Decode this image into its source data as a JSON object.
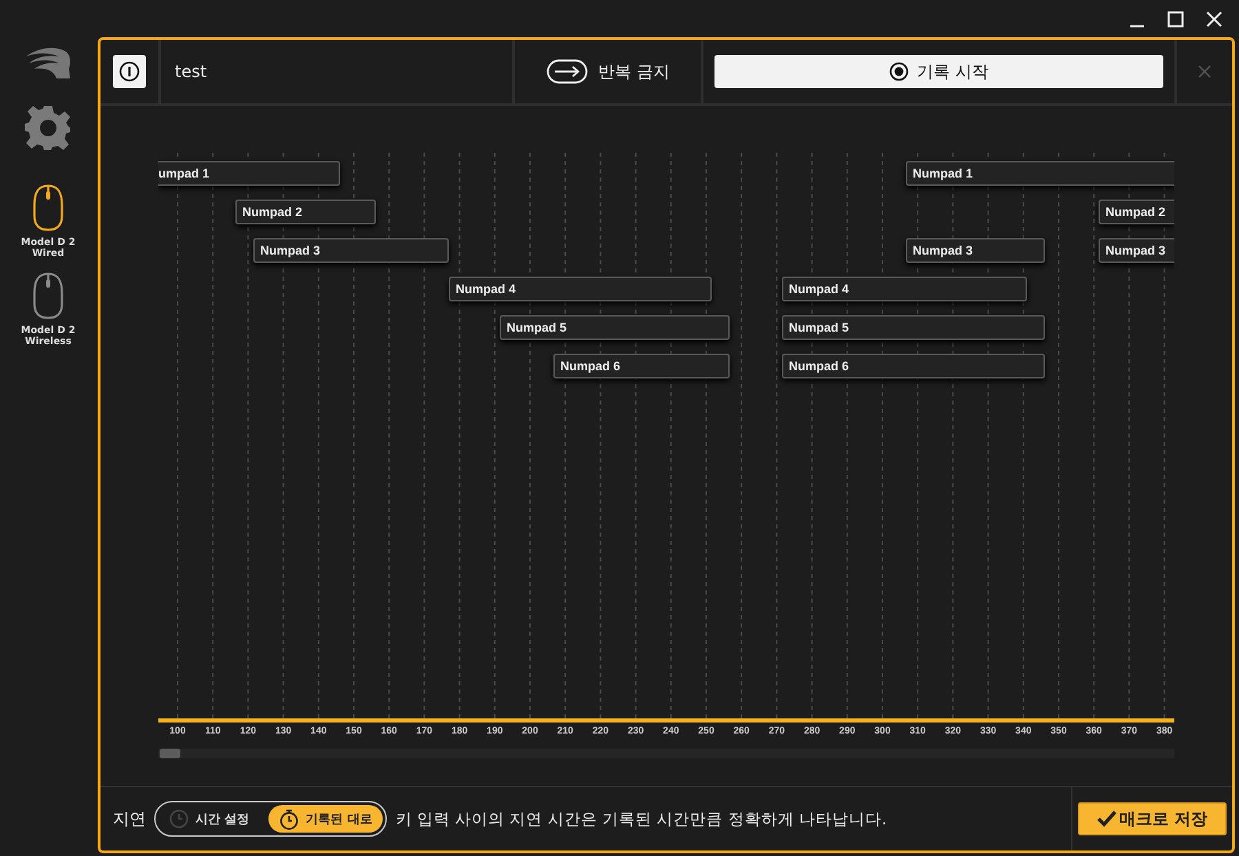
{
  "sidebar": {
    "devices": [
      {
        "label": "Model D 2 Wired",
        "selected": true
      },
      {
        "label": "Model D 2 Wireless",
        "selected": false
      }
    ]
  },
  "header": {
    "macro_name": "test",
    "repeat": {
      "label": "반복 금지"
    },
    "record_button": {
      "label": "기록 시작"
    }
  },
  "timeline": {
    "tracks": [
      {
        "events": [
          {
            "label": "umpad 1"
          },
          {
            "label": "Numpad 1"
          }
        ]
      },
      {
        "events": [
          {
            "label": "Numpad 2"
          },
          {
            "label": "Numpad 2"
          }
        ]
      },
      {
        "events": [
          {
            "label": "Numpad 3"
          },
          {
            "label": "Numpad 3"
          },
          {
            "label": "Numpad 3"
          }
        ]
      },
      {
        "events": [
          {
            "label": "Numpad 4"
          },
          {
            "label": "Numpad 4"
          }
        ]
      },
      {
        "events": [
          {
            "label": "Numpad 5"
          },
          {
            "label": "Numpad 5"
          }
        ]
      },
      {
        "events": [
          {
            "label": "Numpad 6"
          },
          {
            "label": "Numpad 6"
          }
        ]
      }
    ],
    "ticks": [
      "100",
      "110",
      "120",
      "130",
      "140",
      "150",
      "160",
      "170",
      "180",
      "190",
      "200",
      "210",
      "220",
      "230",
      "240",
      "250",
      "260",
      "270",
      "280",
      "290",
      "300",
      "310",
      "320",
      "330",
      "340",
      "350",
      "360",
      "370",
      "380"
    ]
  },
  "footer": {
    "delay_label": "지연",
    "delay_modes": [
      {
        "label": "시간 설정",
        "selected": false
      },
      {
        "label": "기록된 대로",
        "selected": true
      }
    ],
    "description": "키 입력 사이의 지연 시간은 기록된 시간만큼 정확하게 나타납니다.",
    "save_button": "매크로 저장"
  }
}
